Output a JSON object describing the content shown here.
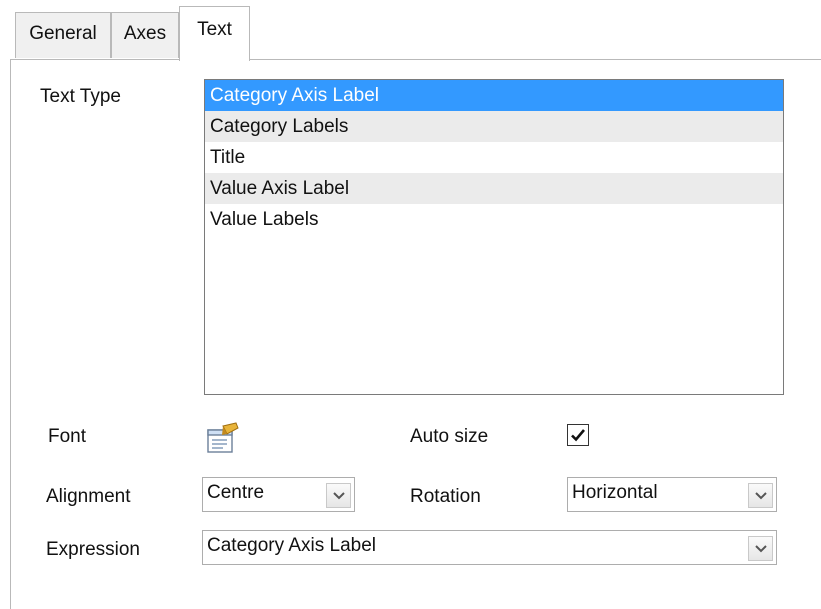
{
  "tabs": [
    {
      "label": "General"
    },
    {
      "label": "Axes"
    },
    {
      "label": "Text",
      "active": true
    }
  ],
  "text_type": {
    "label": "Text Type",
    "items": [
      {
        "label": "Category Axis Label",
        "selected": true
      },
      {
        "label": "Category Labels"
      },
      {
        "label": "Title"
      },
      {
        "label": "Value Axis Label"
      },
      {
        "label": "Value Labels"
      }
    ]
  },
  "font": {
    "label": "Font",
    "icon": "font-properties-icon"
  },
  "auto_size": {
    "label": "Auto size",
    "checked": true
  },
  "alignment": {
    "label": "Alignment",
    "value": "Centre"
  },
  "rotation": {
    "label": "Rotation",
    "value": "Horizontal"
  },
  "expression": {
    "label": "Expression",
    "value": "Category Axis Label"
  },
  "colors": {
    "selection": "#3399ff",
    "alt_row": "#ebebeb"
  }
}
